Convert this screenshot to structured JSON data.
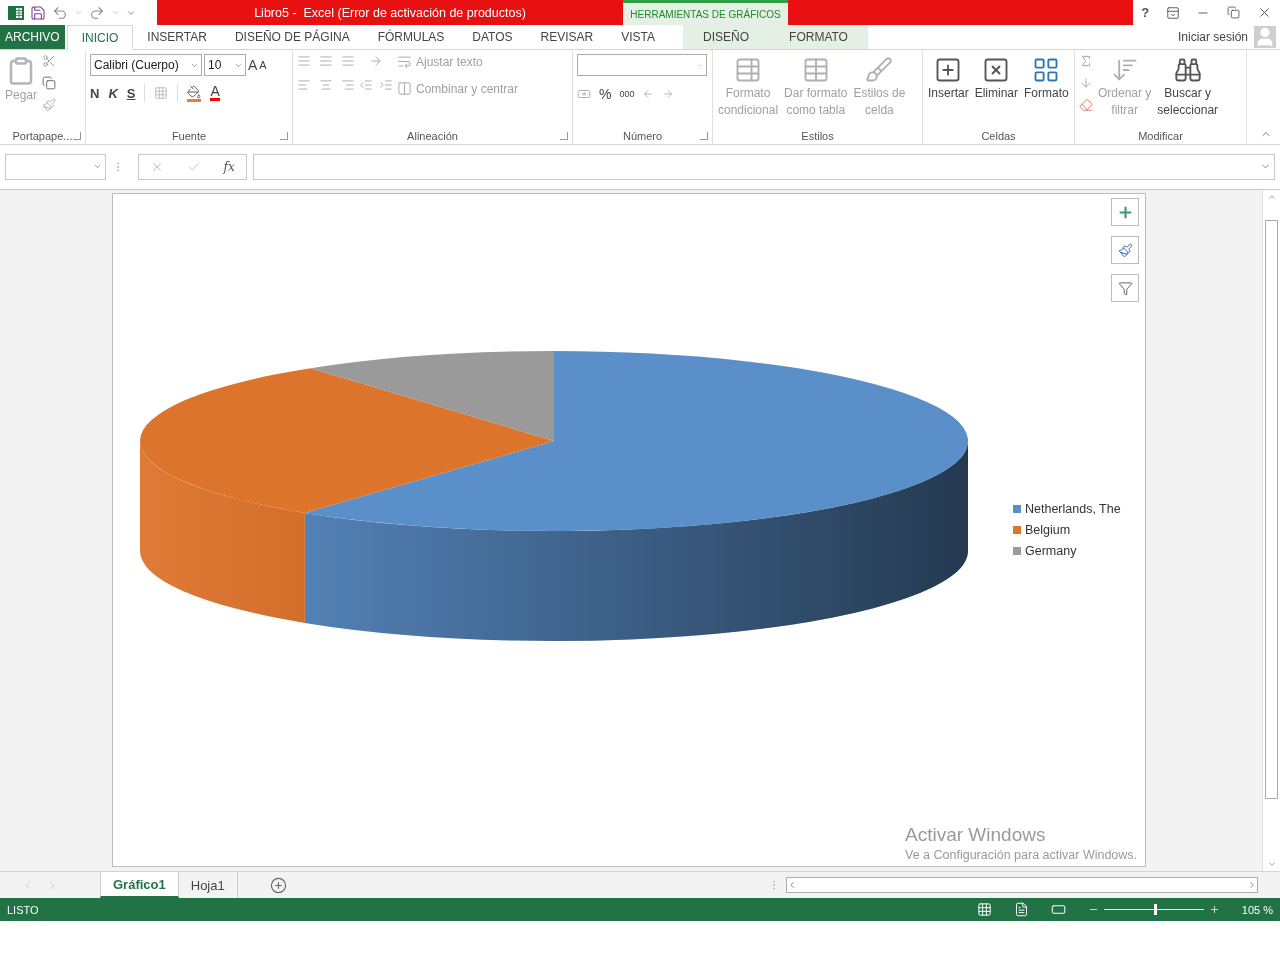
{
  "window": {
    "title": "Libro5 -  Excel (Error de activación de productos)",
    "context_group": "HERRAMIENTAS DE GRÁFICOS",
    "help": "?"
  },
  "tabs": [
    {
      "label": "ARCHIVO",
      "kind": "file",
      "selected": false
    },
    {
      "label": "INICIO",
      "kind": "tab",
      "selected": true
    },
    {
      "label": "INSERTAR",
      "kind": "tab",
      "selected": false
    },
    {
      "label": "DISEÑO DE PÁGINA",
      "kind": "tab",
      "selected": false
    },
    {
      "label": "FÓRMULAS",
      "kind": "tab",
      "selected": false
    },
    {
      "label": "DATOS",
      "kind": "tab",
      "selected": false
    },
    {
      "label": "REVISAR",
      "kind": "tab",
      "selected": false
    },
    {
      "label": "VISTA",
      "kind": "tab",
      "selected": false
    },
    {
      "label": "DISEÑO",
      "kind": "context",
      "selected": false
    },
    {
      "label": "FORMATO",
      "kind": "context",
      "selected": false
    }
  ],
  "account": {
    "label": "Iniciar sesión"
  },
  "ribbon": {
    "clipboard": {
      "label": "Portapape...",
      "paste": {
        "label": "Pegar",
        "disabled": true
      }
    },
    "font": {
      "label": "Fuente",
      "font_name": "Calibri (Cuerpo)",
      "font_size": "10",
      "grow_font": "A",
      "shrink_font": "A",
      "bold": "N",
      "italic": "K",
      "underline": "S",
      "font_color": "A"
    },
    "alignment": {
      "label": "Alineación",
      "wrap": {
        "label": "Ajustar texto",
        "disabled": true
      },
      "merge": {
        "label": "Combinar y centrar",
        "disabled": true
      }
    },
    "number": {
      "label": "Número",
      "percent": "%",
      "thousands": "000"
    },
    "styles": {
      "label": "Estilos",
      "buttons": [
        {
          "lines": [
            "Formato",
            "condicional"
          ],
          "disabled": true
        },
        {
          "lines": [
            "Dar formato",
            "como tabla"
          ],
          "disabled": true
        },
        {
          "lines": [
            "Estilos de",
            "celda"
          ],
          "disabled": true
        }
      ]
    },
    "cells": {
      "label": "Celdas",
      "buttons": [
        {
          "lines": [
            "Insertar"
          ],
          "disabled": false
        },
        {
          "lines": [
            "Eliminar"
          ],
          "disabled": false
        },
        {
          "lines": [
            "Formato"
          ],
          "disabled": false
        }
      ]
    },
    "editing": {
      "label": "Modificar",
      "buttons": [
        {
          "lines": [
            "Ordenar y",
            "filtrar"
          ],
          "disabled": true
        },
        {
          "lines": [
            "Buscar y",
            "seleccionar"
          ],
          "disabled": false
        }
      ]
    }
  },
  "formula_bar": {
    "function_label": "fx"
  },
  "chart": {
    "legend": [
      {
        "label": "Netherlands, The",
        "color": "#5b8fc9"
      },
      {
        "label": "Belgium",
        "color": "#dd742c"
      },
      {
        "label": "Germany",
        "color": "#9a9a9a"
      }
    ]
  },
  "watermark": {
    "title": "Activar Windows",
    "text": "Ve a Configuración para activar Windows."
  },
  "sheets": [
    {
      "label": "Gráfico1",
      "selected": true
    },
    {
      "label": "Hoja1",
      "selected": false
    }
  ],
  "status_bar": {
    "text": "LISTO",
    "zoom": "105 %",
    "zoom_slider": {
      "level": 0.51
    }
  }
}
